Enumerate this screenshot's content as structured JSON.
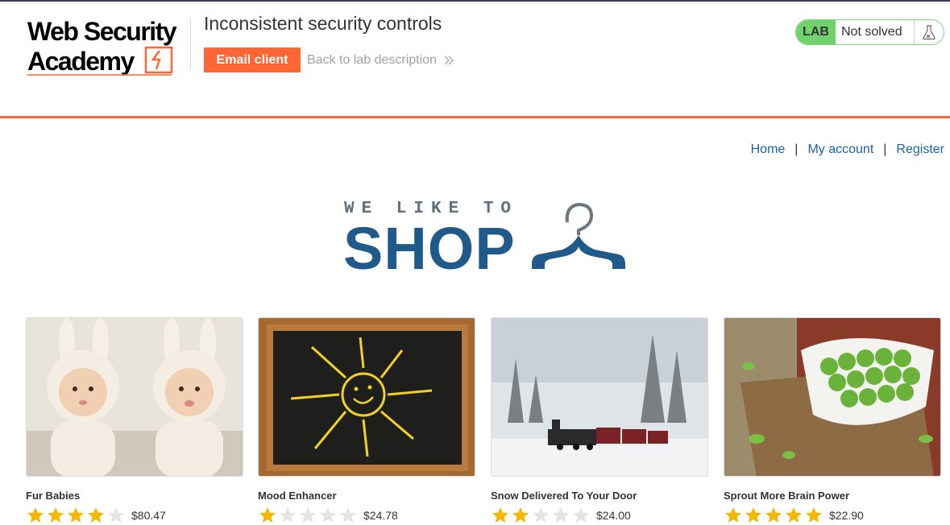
{
  "header": {
    "logo_line1": "Web Security",
    "logo_line2": "Academy",
    "lab_title": "Inconsistent security controls",
    "email_client": "Email client",
    "back_link": "Back to lab description"
  },
  "lab_status": {
    "badge": "LAB",
    "state": "Not solved",
    "icon": "flask-icon"
  },
  "nav": {
    "home": "Home",
    "account": "My account",
    "register": "Register",
    "separator": "|"
  },
  "hero": {
    "small": "WE LIKE TO",
    "big": "SHOP"
  },
  "colors": {
    "accent": "#ff6633",
    "link": "#1a5fb4",
    "lab_green": "#70d16d",
    "star_gold": "#f5b800",
    "hero_blue": "#1f5a8a"
  },
  "products": [
    {
      "name": "Fur Babies",
      "rating": 4,
      "price": "$80.47"
    },
    {
      "name": "Mood Enhancer",
      "rating": 1,
      "price": "$24.78"
    },
    {
      "name": "Snow Delivered To Your Door",
      "rating": 2,
      "price": "$24.00"
    },
    {
      "name": "Sprout More Brain Power",
      "rating": 5,
      "price": "$22.90"
    }
  ]
}
